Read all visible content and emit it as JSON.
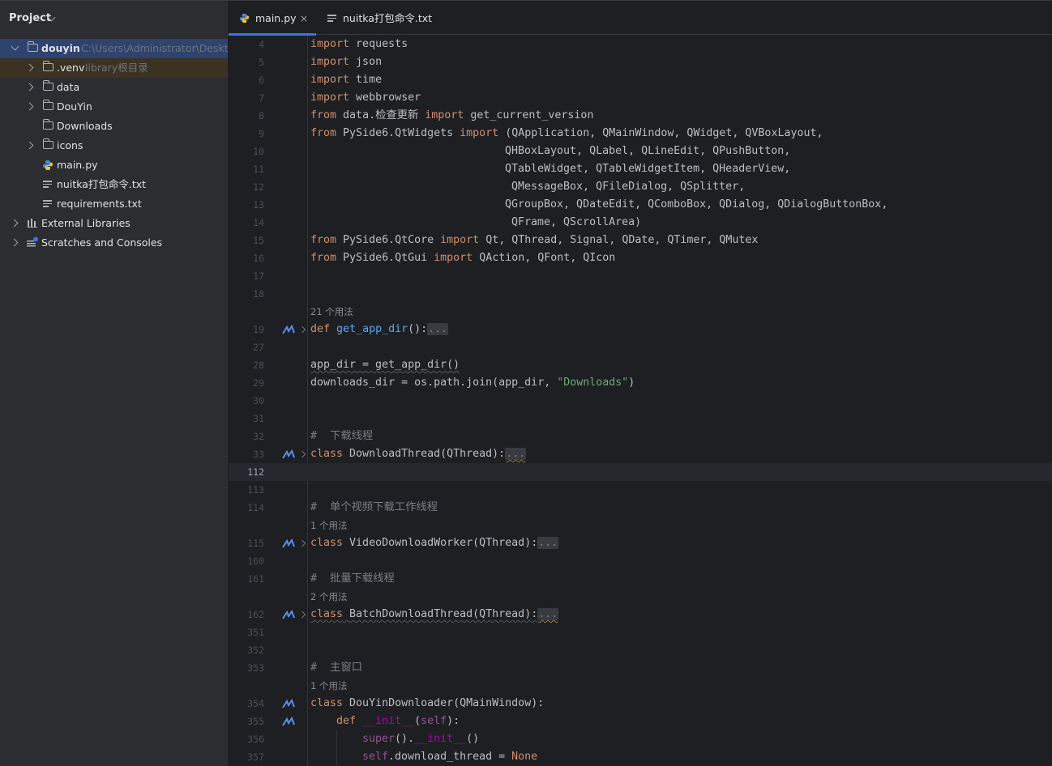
{
  "project_panel": {
    "title": "Project",
    "tree": [
      {
        "label": "douyin",
        "hint": "C:\\Users\\Administrator\\Desktop",
        "icon": "folder-icon",
        "expanded": true
      },
      {
        "label": ".venv",
        "hint": "library根目录",
        "icon": "folder-icon"
      },
      {
        "label": "data",
        "icon": "folder-icon"
      },
      {
        "label": "DouYin",
        "icon": "folder-icon"
      },
      {
        "label": "Downloads",
        "icon": "folder-icon"
      },
      {
        "label": "icons",
        "icon": "folder-icon"
      },
      {
        "label": "main.py",
        "icon": "python-file-icon"
      },
      {
        "label": "nuitka打包命令.txt",
        "icon": "text-file-icon"
      },
      {
        "label": "requirements.txt",
        "icon": "text-file-icon"
      },
      {
        "label": "External Libraries",
        "icon": "library-icon"
      },
      {
        "label": "Scratches and Consoles",
        "icon": "scratches-icon"
      }
    ]
  },
  "tabs": [
    {
      "label": "main.py",
      "close": "×",
      "active": true
    },
    {
      "label": "nuitka打包命令.txt",
      "active": false
    }
  ],
  "editor": {
    "line_numbers": [
      "4",
      "5",
      "6",
      "7",
      "8",
      "9",
      "10",
      "11",
      "12",
      "13",
      "14",
      "15",
      "16",
      "17",
      "18",
      "19",
      "27",
      "28",
      "29",
      "30",
      "31",
      "32",
      "33",
      "112",
      "113",
      "114",
      "115",
      "160",
      "161",
      "162",
      "351",
      "352",
      "353",
      "354",
      "355",
      "356",
      "357"
    ],
    "current_line": "112",
    "usages": [
      "21 个用法",
      "1 个用法",
      "2 个用法",
      "1 个用法"
    ],
    "code": {
      "l4": "import requests",
      "l5": "import json",
      "l6": "import time",
      "l7": "import webbrowser",
      "l8a": "data.检查更新",
      "l8b": "get_current_version",
      "l9a": "PySide6.QtWidgets",
      "l9b": "(QApplication, QMainWindow, QWidget, QVBoxLayout,",
      "l10": "QHBoxLayout, QLabel, QLineEdit, QPushButton,",
      "l11": "QTableWidget, QTableWidgetItem, QHeaderView,",
      "l12": "QMessageBox, QFileDialog, QSplitter,",
      "l13": "QGroupBox, QDateEdit, QComboBox, QDialog, QDialogButtonBox,",
      "l14": "QFrame, QScrollArea)",
      "l15a": "PySide6.QtCore",
      "l15b": "Qt, QThread, Signal, QDate, QTimer, QMutex",
      "l16a": "PySide6.QtGui",
      "l16b": "QAction, QFont, QIcon",
      "l19": "get_app_dir",
      "l28": "app_dir = get_app_dir()",
      "l29a": "downloads_dir = os.path.join(app_dir, ",
      "l29b": "\"Downloads\"",
      "l32": "#  下载线程",
      "l33": "DownloadThread(QThread):",
      "l114": "#  单个视频下载工作线程",
      "l115": "VideoDownloadWorker(QThread):",
      "l161": "#  批量下载线程",
      "l162": "BatchDownloadThread(QThread):",
      "l353": "#  主窗口",
      "l354": "DouYinDownloader(QMainWindow):",
      "l355": "__init__",
      "l356": "__init__",
      "l357a": ".download_thread = ",
      "l357b": "None"
    },
    "fold_placeholder": "...",
    "kw": {
      "import": "import",
      "from": "from",
      "def": "def",
      "class": "class",
      "self": "self",
      "super": "super"
    }
  },
  "colors": {
    "accent": "#3574f0",
    "keyword": "#cf8e6d",
    "function": "#56a8f5",
    "string": "#6aab73"
  }
}
